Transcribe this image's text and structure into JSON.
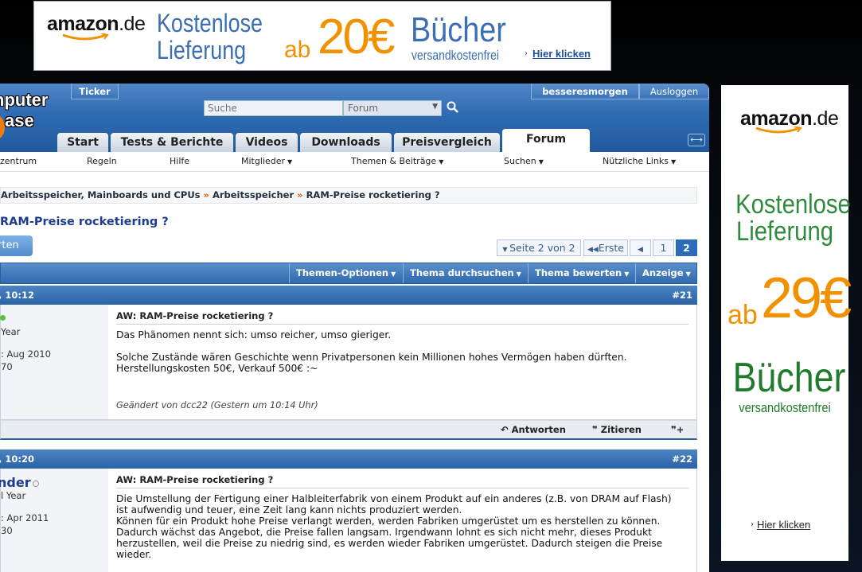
{
  "top_ad": {
    "logo_main": "amazon",
    "logo_tld": ".de",
    "line1": "Kostenlose",
    "line2": "Lieferung",
    "ab": "ab",
    "price": "20€",
    "product": "Bücher",
    "sub": "versandkostenfrei",
    "click": "Hier klicken",
    "accent_color": "#f29100",
    "text_color": "#3c6eb2"
  },
  "side_ad": {
    "logo_main": "amazon",
    "logo_tld": ".de",
    "line1": "Kostenlose",
    "line2": "Lieferung",
    "ab": "ab",
    "price": "29€",
    "product": "Bücher",
    "sub": "versandkostenfrei",
    "click": "Hier klicken",
    "accent_color": "#f29100",
    "text_color": "#2f8a3d"
  },
  "header": {
    "logo_line1": "nputer",
    "logo_line2": "ase",
    "ticker": "Ticker",
    "user": "besseresmorgen",
    "logout": "Ausloggen",
    "search_placeholder": "Suche",
    "search_scope": "Forum",
    "tabs": [
      {
        "label": "Start"
      },
      {
        "label": "Tests & Berichte"
      },
      {
        "label": "Videos"
      },
      {
        "label": "Downloads"
      },
      {
        "label": "Preisvergleich"
      },
      {
        "label": "Forum",
        "active": true
      }
    ]
  },
  "subnav": [
    {
      "label": "zentrum"
    },
    {
      "label": "Regeln"
    },
    {
      "label": "Hilfe"
    },
    {
      "label": "Mitglieder",
      "dropdown": true
    },
    {
      "label": "Themen & Beiträge",
      "dropdown": true
    },
    {
      "label": "Suchen",
      "dropdown": true
    },
    {
      "label": "Nützliche Links",
      "dropdown": true
    }
  ],
  "breadcrumb": {
    "items": [
      "Arbeitsspeicher, Mainboards und CPUs",
      "Arbeitsspeicher",
      "RAM-Preise rocketiering ?"
    ],
    "separator": "»"
  },
  "thread": {
    "title": "RAM-Preise rocketiering ?",
    "reply_button": "rten",
    "pager": {
      "page_info": "Seite 2 von 2",
      "first": "Erste",
      "pages": [
        "1",
        "2"
      ],
      "current": "2"
    },
    "toolbar": [
      "Themen-Optionen",
      "Thema durchsuchen",
      "Thema bewerten",
      "Anzeige"
    ]
  },
  "posts": [
    {
      "date": ", 10:12",
      "number": "#21",
      "user_lines": [
        "Year",
        ": Aug 2010",
        "70"
      ],
      "title": "AW: RAM-Preise rocketiering ?",
      "text": "Das Phänomen nennt sich: umso reicher, umso gieriger.\n\nSolche Zustände wären Geschichte wenn Privatpersonen kein Millionen hohes Vermögen haben dürften.\nHerstellungskosten 50€, Verkauf 500€ :~",
      "edited": "Geändert von dcc22 (Gestern um 10:14 Uhr)",
      "actions": [
        "Antworten",
        "Zitieren"
      ]
    },
    {
      "date": ", 10:20",
      "number": "#22",
      "username": "nder",
      "user_lines": [
        "l Year",
        ": Apr 2011",
        "30"
      ],
      "title": "AW: RAM-Preise rocketiering ?",
      "text": "Die Umstellung der Fertigung einer Halbleiterfabrik von einem Produkt auf ein anderes (z.B. von DRAM auf Flash)\nist aufwendig und teuer, eine Zeit lang kann nichts produziert werden.\nKönnen für ein Produkt hohe Preise verlangt werden, werden Fabriken umgerüstet um es herstellen zu können.\nDadurch wächst das Angebot, die Preise fallen langsam. Irgendwann lohnt es sich nicht mehr, dieses Produkt\nherzustellen, weil die Preise zu niedrig sind, es werden wieder Fabriken umgerüstet. Dadurch steigen die Preise\nwieder."
    }
  ]
}
